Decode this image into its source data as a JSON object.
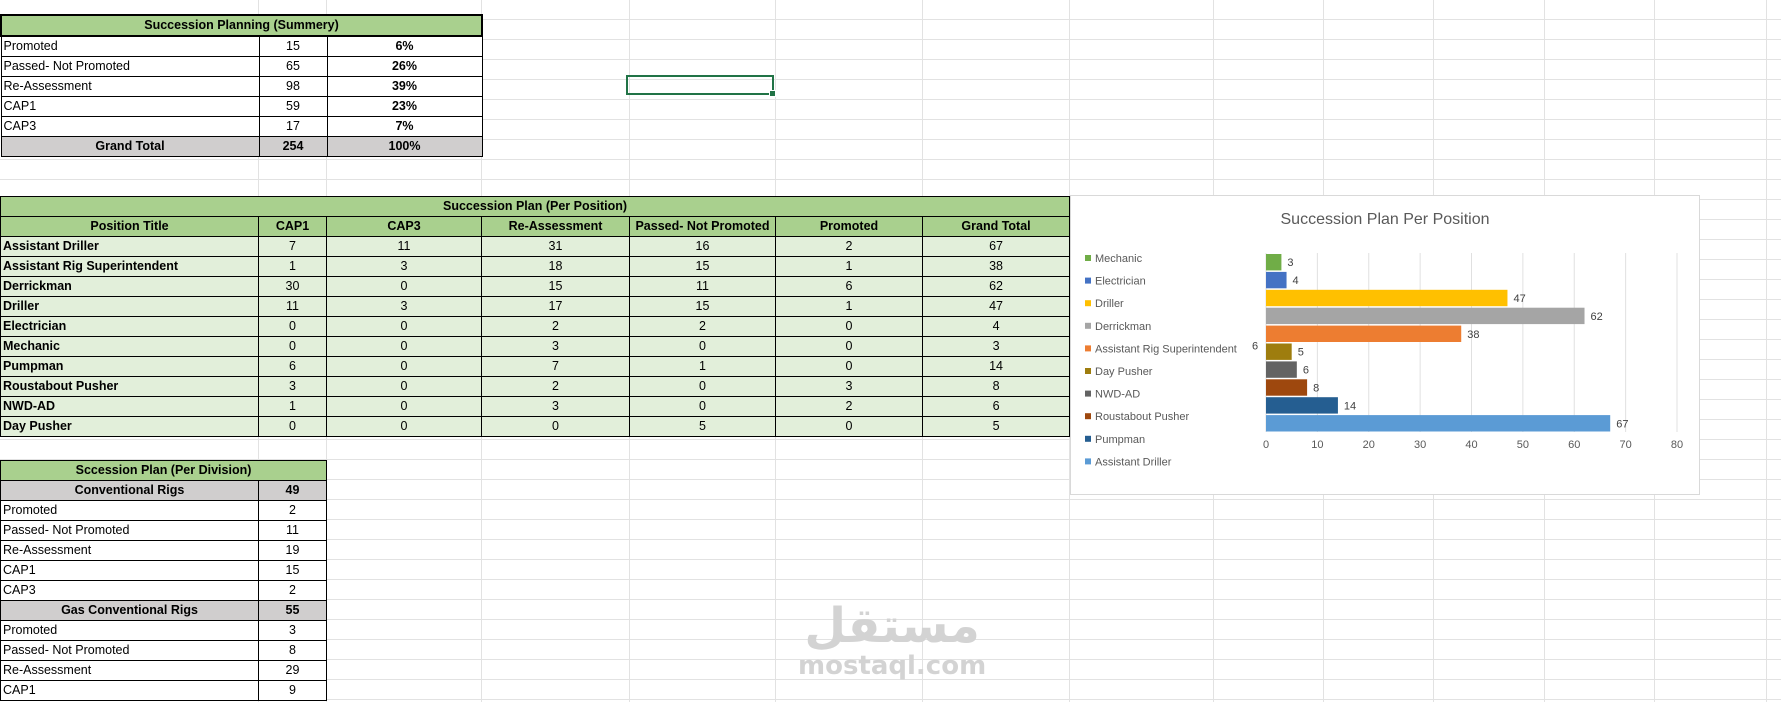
{
  "summary": {
    "title": "Succession Planning (Summery)",
    "rows": [
      {
        "label": "Promoted",
        "count": "15",
        "pct": "6%"
      },
      {
        "label": "Passed- Not Promoted",
        "count": "65",
        "pct": "26%"
      },
      {
        "label": "Re-Assessment",
        "count": "98",
        "pct": "39%"
      },
      {
        "label": "CAP1",
        "count": "59",
        "pct": "23%"
      },
      {
        "label": "CAP3",
        "count": "17",
        "pct": "7%"
      }
    ],
    "total": {
      "label": "Grand Total",
      "count": "254",
      "pct": "100%"
    }
  },
  "position": {
    "title": "Succession Plan (Per Position)",
    "headers": [
      "Position Title",
      "CAP1",
      "CAP3",
      "Re-Assessment",
      "Passed- Not Promoted",
      "Promoted",
      "Grand Total"
    ],
    "rows": [
      [
        "Assistant Driller",
        "7",
        "11",
        "31",
        "16",
        "2",
        "67"
      ],
      [
        "Assistant Rig Superintendent",
        "1",
        "3",
        "18",
        "15",
        "1",
        "38"
      ],
      [
        "Derrickman",
        "30",
        "0",
        "15",
        "11",
        "6",
        "62"
      ],
      [
        "Driller",
        "11",
        "3",
        "17",
        "15",
        "1",
        "47"
      ],
      [
        "Electrician",
        "0",
        "0",
        "2",
        "2",
        "0",
        "4"
      ],
      [
        "Mechanic",
        "0",
        "0",
        "3",
        "0",
        "0",
        "3"
      ],
      [
        "Pumpman",
        "6",
        "0",
        "7",
        "1",
        "0",
        "14"
      ],
      [
        "Roustabout Pusher",
        "3",
        "0",
        "2",
        "0",
        "3",
        "8"
      ],
      [
        "NWD-AD",
        "1",
        "0",
        "3",
        "0",
        "2",
        "6"
      ],
      [
        "Day Pusher",
        "0",
        "0",
        "0",
        "5",
        "0",
        "5"
      ]
    ]
  },
  "division": {
    "title": "Sccession Plan (Per Division)",
    "groups": [
      {
        "name": "Conventional Rigs",
        "total": "49",
        "rows": [
          [
            "Promoted",
            "2"
          ],
          [
            "Passed- Not Promoted",
            "11"
          ],
          [
            "Re-Assessment",
            "19"
          ],
          [
            "CAP1",
            "15"
          ],
          [
            "CAP3",
            "2"
          ]
        ]
      },
      {
        "name": "Gas Conventional Rigs",
        "total": "55",
        "rows": [
          [
            "Promoted",
            "3"
          ],
          [
            "Passed- Not Promoted",
            "8"
          ],
          [
            "Re-Assessment",
            "29"
          ],
          [
            "CAP1",
            "9"
          ]
        ]
      }
    ]
  },
  "chart_data": {
    "type": "bar",
    "orientation": "horizontal",
    "title": "Succession Plan Per Position",
    "xlim": [
      0,
      80
    ],
    "xticks": [
      0,
      10,
      20,
      30,
      40,
      50,
      60,
      70,
      80
    ],
    "grid": true,
    "legend_position": "left",
    "series": [
      {
        "name": "Mechanic",
        "value": 3,
        "color": "#70ad47"
      },
      {
        "name": "Electrician",
        "value": 4,
        "color": "#4472c4"
      },
      {
        "name": "Driller",
        "value": 47,
        "color": "#ffc000"
      },
      {
        "name": "Derrickman",
        "value": 62,
        "color": "#a5a5a5"
      },
      {
        "name": "Assistant Rig Superintendent",
        "value": 38,
        "color": "#ed7d31"
      },
      {
        "name": "Day Pusher",
        "value": 5,
        "color": "#9e7d0e"
      },
      {
        "name": "NWD-AD",
        "value": 6,
        "color": "#636363"
      },
      {
        "name": "Roustabout Pusher",
        "value": 8,
        "color": "#9e480e"
      },
      {
        "name": "Pumpman",
        "value": 14,
        "color": "#255e91"
      },
      {
        "name": "Assistant Driller",
        "value": 67,
        "color": "#5b9bd5"
      }
    ],
    "stray_label": "6"
  },
  "watermark": {
    "arabic": "مستقل",
    "latin": "mostaql.com"
  }
}
